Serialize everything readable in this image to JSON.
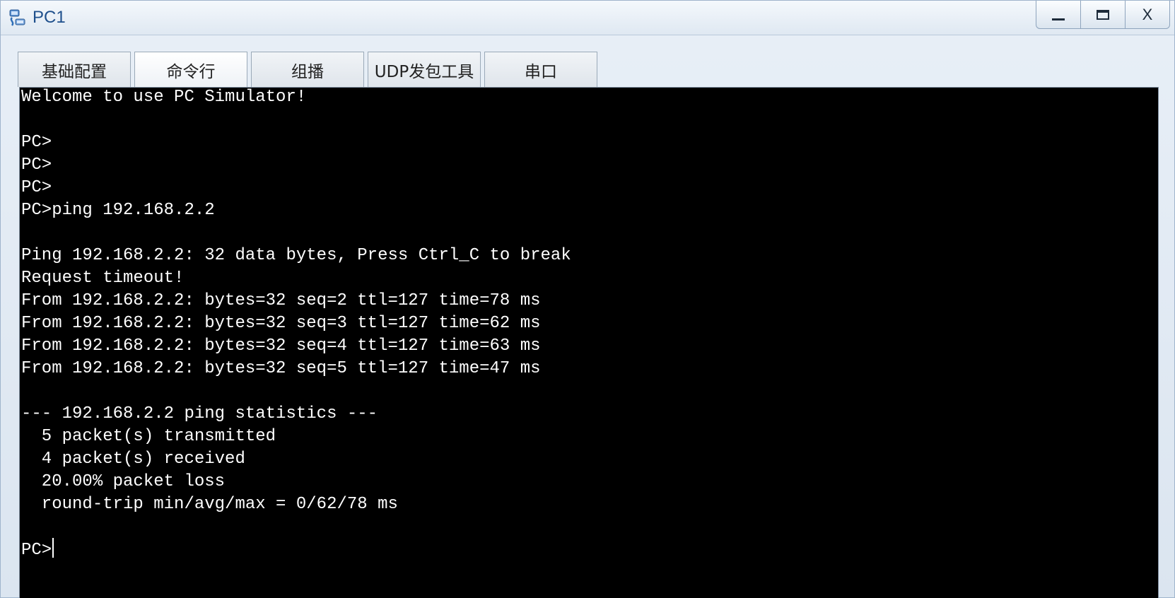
{
  "window": {
    "title": "PC1",
    "icon": "pc-icon",
    "controls": {
      "minimize": "minimize-icon",
      "maximize": "maximize-icon",
      "close_label": "X"
    }
  },
  "tabs": [
    {
      "label": "基础配置",
      "active": false
    },
    {
      "label": "命令行",
      "active": true
    },
    {
      "label": "组播",
      "active": false
    },
    {
      "label": "UDP发包工具",
      "active": false
    },
    {
      "label": "串口",
      "active": false
    }
  ],
  "terminal": {
    "lines": [
      "Welcome to use PC Simulator!",
      "",
      "PC>",
      "PC>",
      "PC>",
      "PC>ping 192.168.2.2",
      "",
      "Ping 192.168.2.2: 32 data bytes, Press Ctrl_C to break",
      "Request timeout!",
      "From 192.168.2.2: bytes=32 seq=2 ttl=127 time=78 ms",
      "From 192.168.2.2: bytes=32 seq=3 ttl=127 time=62 ms",
      "From 192.168.2.2: bytes=32 seq=4 ttl=127 time=63 ms",
      "From 192.168.2.2: bytes=32 seq=5 ttl=127 time=47 ms",
      "",
      "--- 192.168.2.2 ping statistics ---",
      "  5 packet(s) transmitted",
      "  4 packet(s) received",
      "  20.00% packet loss",
      "  round-trip min/avg/max = 0/62/78 ms",
      "",
      "PC>"
    ]
  }
}
